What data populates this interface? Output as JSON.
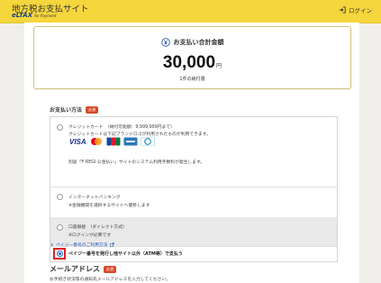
{
  "header": {
    "title": "地方税お支払サイト",
    "logo_text": "eLTAX",
    "logo_sub": "for Payment",
    "login_label": "ログイン"
  },
  "summary": {
    "heading": "お支払い合計金額",
    "amount": "30,000",
    "unit": "円",
    "count": "1件の納付書"
  },
  "payment_method": {
    "title": "お支払い方法",
    "required_badge": "必須",
    "options": [
      {
        "name": "クレジットカード",
        "line1": "クレジットカード　（納付可能額：9,999,999円まで）",
        "line2": "クレジットカードは下記ブランドロゴが利用されたものが利用できます。",
        "note": "別途「F-REGI 公金払い」サイトのシステム利用手数料が発生します。",
        "card_brands": [
          "VISA",
          "Mastercard",
          "JCB",
          "American Express",
          "Diners Club"
        ],
        "selected": false
      },
      {
        "name": "インターネットバンキング",
        "line1": "インターネットバンキング",
        "line2": "※金融機関を選択するサイトへ遷移します",
        "selected": false
      },
      {
        "name": "口座振替",
        "line1": "口座振替　（ダイレクト方式）",
        "line2": "※ログインが必要です",
        "selected": false
      },
      {
        "name": "ペイジー",
        "line1": "ペイジー番号を発行し他サイト以外（ATM等）で支払う",
        "selected": true
      }
    ],
    "help_link": "ペイジー番号のご利用方法"
  },
  "email": {
    "title": "メールアドレス",
    "required_badge": "必須",
    "hint": "お手続き状況等の通知先メールアドレスを入力してください。"
  },
  "colors": {
    "header_bg": "#f5d63d",
    "accent_blue": "#1e67d8",
    "highlight_red": "#e32020",
    "badge_red": "#d64a2a"
  }
}
